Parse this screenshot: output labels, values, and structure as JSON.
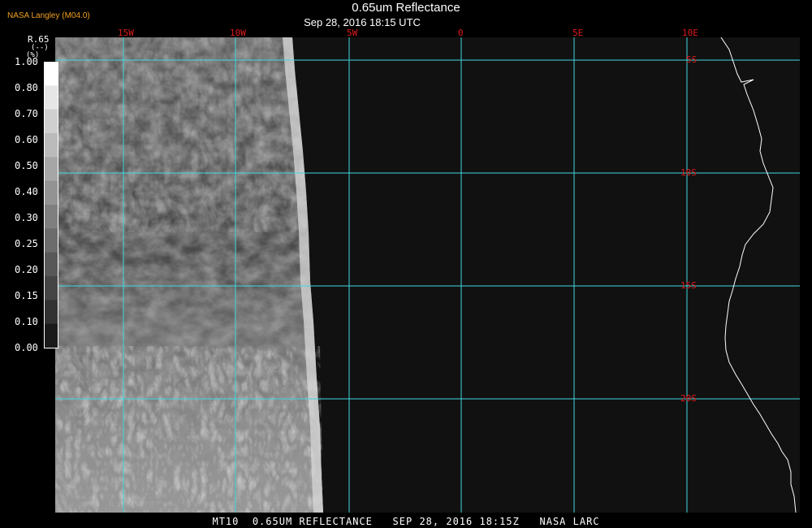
{
  "header": {
    "credit": "NASA Langley (M04.0)",
    "title": "0.65um Reflectance",
    "subtitle": "Sep 28, 2016 18:15 UTC"
  },
  "legend": {
    "title": "R.65",
    "unit": "(--)",
    "pct": "(%)",
    "ticks": [
      "1.00",
      "0.80",
      "0.70",
      "0.60",
      "0.50",
      "0.40",
      "0.30",
      "0.25",
      "0.20",
      "0.15",
      "0.10",
      "0.00"
    ],
    "grays": [
      "#ffffff",
      "#e6e6e6",
      "#cfcfcf",
      "#bbbbbb",
      "#a6a6a6",
      "#939393",
      "#7f7f7f",
      "#6c6c6c",
      "#585858",
      "#454545",
      "#323232",
      "#1a1a1a"
    ]
  },
  "map": {
    "lon_labels": [
      "15W",
      "10W",
      "5W",
      "0",
      "5E",
      "10E"
    ],
    "lat_labels": [
      "5S",
      "10S",
      "15S",
      "20S"
    ],
    "grid_color": "#40d8e0",
    "label_color": "#e01a1a",
    "coast_color": "#ffffff",
    "background": "#111111"
  },
  "footer": {
    "text": "MT10  0.65UM REFLECTANCE   SEP 28, 2016 18:15Z   NASA LARC"
  }
}
